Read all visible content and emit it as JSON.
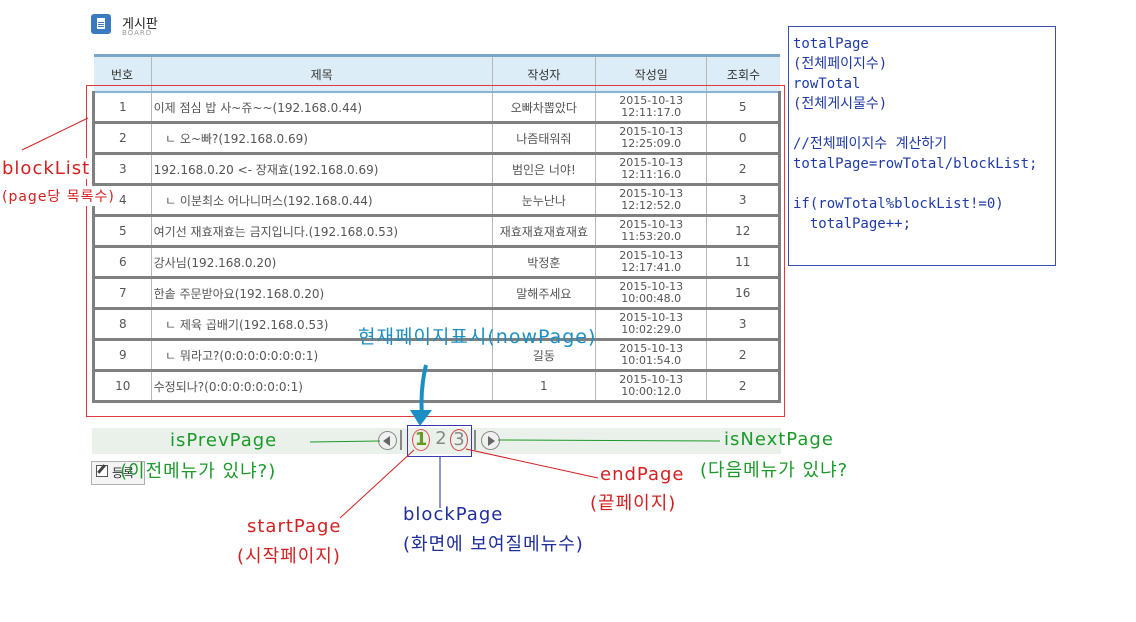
{
  "board": {
    "title": "게시판",
    "subtitle": "BOARD"
  },
  "table": {
    "headers": [
      "번호",
      "제목",
      "작성자",
      "작성일",
      "조회수"
    ],
    "rows": [
      {
        "no": "1",
        "title": "이제 점심 밥 사~쥬~~(192.168.0.44)",
        "author": "오빠차뽑았다",
        "date": "2015-10-13",
        "time": "12:11:17.0",
        "views": "5"
      },
      {
        "no": "2",
        "title": "   ㄴ 오~빠?(192.168.0.69)",
        "author": "나즘태워줘",
        "date": "2015-10-13",
        "time": "12:25:09.0",
        "views": "0"
      },
      {
        "no": "3",
        "title": "192.168.0.20 <- 장재효(192.168.0.69)",
        "author": "범인은 너야!",
        "date": "2015-10-13",
        "time": "12:11:16.0",
        "views": "2"
      },
      {
        "no": "4",
        "title": "   ㄴ 이분최소 어나니머스(192.168.0.44)",
        "author": "눈누난나",
        "date": "2015-10-13",
        "time": "12:12:52.0",
        "views": "3"
      },
      {
        "no": "5",
        "title": "여기선 재효재효는 금지입니다.(192.168.0.53)",
        "author": "재효재효재효재효",
        "date": "2015-10-13",
        "time": "11:53:20.0",
        "views": "12"
      },
      {
        "no": "6",
        "title": "강사님(192.168.0.20)",
        "author": "박정훈",
        "date": "2015-10-13",
        "time": "12:17:41.0",
        "views": "11"
      },
      {
        "no": "7",
        "title": "한솥 주문받아요(192.168.0.20)",
        "author": "말해주세요",
        "date": "2015-10-13",
        "time": "10:00:48.0",
        "views": "16"
      },
      {
        "no": "8",
        "title": "   ㄴ 제육 곱배기(192.168.0.53)",
        "author": "",
        "date": "2015-10-13",
        "time": "10:02:29.0",
        "views": "3"
      },
      {
        "no": "9",
        "title": "   ㄴ 뭐라고?(0:0:0:0:0:0:0:1)",
        "author": "길동",
        "date": "2015-10-13",
        "time": "10:01:54.0",
        "views": "2"
      },
      {
        "no": "10",
        "title": "수정되나?(0:0:0:0:0:0:0:1)",
        "author": "1",
        "date": "2015-10-13",
        "time": "10:00:12.0",
        "views": "2"
      }
    ]
  },
  "pager": {
    "pages": [
      "1",
      "2",
      "3"
    ],
    "current": "1"
  },
  "write_button": "등록",
  "code": "totalPage\n(전체페이지수)\nrowTotal\n(전체게시물수)\n\n//전체페이지수 계산하기\ntotalPage=rowTotal/blockList;\n\nif(rowTotal%blockList!=0)\n  totalPage++;",
  "annotations": {
    "blockList": "blockList",
    "blockList_desc": "(page당 목록수)",
    "nowPage": "현재페이지표시(nowPage)",
    "isPrevPage": "isPrevPage",
    "isPrevPage_desc": "(이전메뉴가 있냐?)",
    "isNextPage": "isNextPage",
    "isNextPage_desc": "(다음메뉴가 있냐?",
    "endPage": "endPage",
    "endPage_desc": "(끝페이지)",
    "startPage": "startPage",
    "startPage_desc": "(시작페이지)",
    "blockPage": "blockPage",
    "blockPage_desc": "(화면에 보여질메뉴수)"
  },
  "colors": {
    "header_bg": "#dcedf8",
    "annotation_red": "#d42020",
    "annotation_green": "#1b9a2a",
    "annotation_blue": "#1e2e9a",
    "annotation_teal": "#1b8fc4"
  }
}
